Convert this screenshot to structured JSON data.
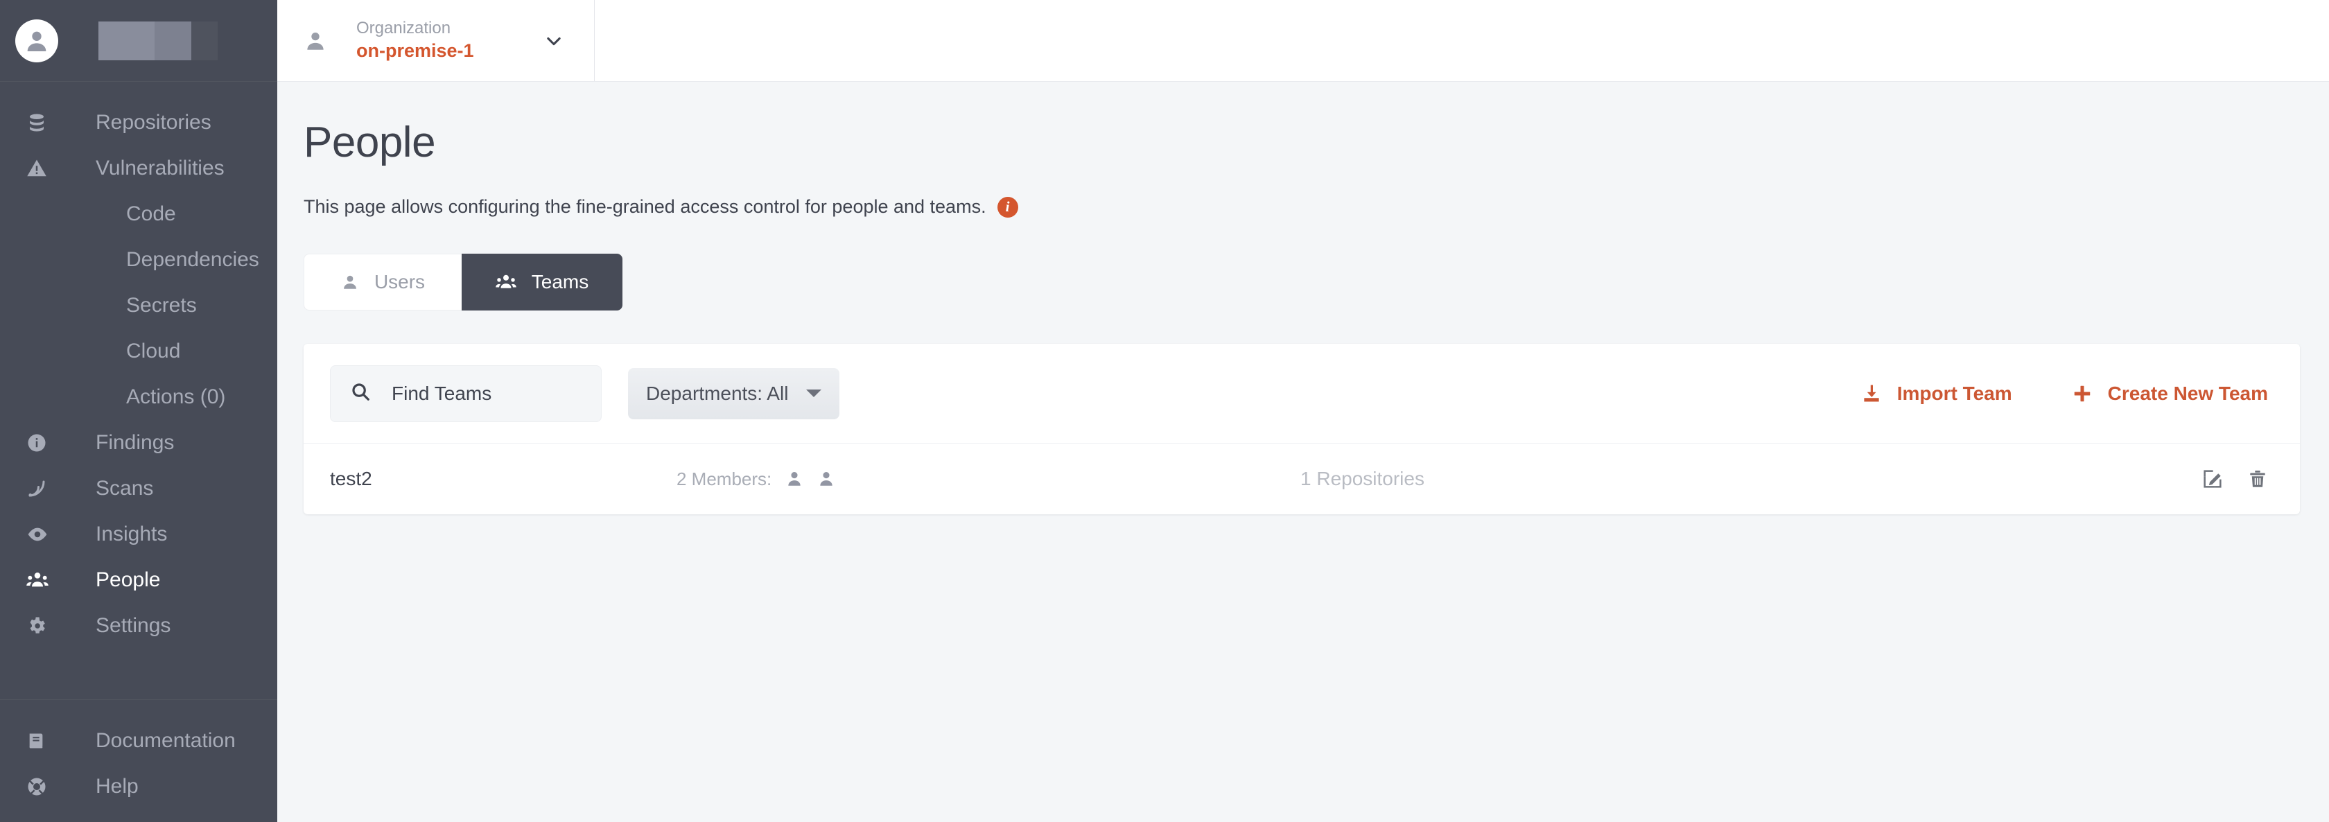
{
  "sidebar": {
    "user_avatar_icon": "user-avatar-icon",
    "redacted_label": "",
    "nav": [
      {
        "label": "Repositories",
        "icon": "database-icon",
        "sub": false,
        "active": false
      },
      {
        "label": "Vulnerabilities",
        "icon": "warning-triangle-icon",
        "sub": false,
        "active": false
      },
      {
        "label": "Code",
        "icon": "",
        "sub": true,
        "active": false
      },
      {
        "label": "Dependencies",
        "icon": "",
        "sub": true,
        "active": false
      },
      {
        "label": "Secrets",
        "icon": "",
        "sub": true,
        "active": false
      },
      {
        "label": "Cloud",
        "icon": "",
        "sub": true,
        "active": false
      },
      {
        "label": "Actions (0)",
        "icon": "",
        "sub": true,
        "active": false
      },
      {
        "label": "Findings",
        "icon": "info-circle-icon",
        "sub": false,
        "active": false
      },
      {
        "label": "Scans",
        "icon": "signal-icon",
        "sub": false,
        "active": false
      },
      {
        "label": "Insights",
        "icon": "eye-icon",
        "sub": false,
        "active": false
      },
      {
        "label": "People",
        "icon": "people-group-icon",
        "sub": false,
        "active": true
      },
      {
        "label": "Settings",
        "icon": "gear-icon",
        "sub": false,
        "active": false
      }
    ],
    "footer_nav": [
      {
        "label": "Documentation",
        "icon": "book-icon"
      },
      {
        "label": "Help",
        "icon": "life-ring-icon"
      }
    ]
  },
  "topbar": {
    "org_icon": "person-icon",
    "org_caption": "Organization",
    "org_value": "on-premise-1",
    "org_caret_icon": "chevron-down-icon"
  },
  "page": {
    "title": "People",
    "description": "This page allows configuring the fine-grained access control for people and teams.",
    "info_icon": "info-icon",
    "info_glyph": "i"
  },
  "tabs": [
    {
      "label": "Users",
      "icon": "person-icon",
      "active": false
    },
    {
      "label": "Teams",
      "icon": "people-group-icon",
      "active": true
    }
  ],
  "toolbar": {
    "search_icon": "search-icon",
    "search_placeholder": "Find Teams",
    "search_value": "",
    "department_filter": "Departments: All",
    "department_caret_icon": "caret-down-icon",
    "import_label": "Import Team",
    "import_icon": "import-download-icon",
    "create_label": "Create New Team",
    "create_icon": "plus-icon"
  },
  "teams": [
    {
      "name": "test2",
      "members_label": "2 Members:",
      "member_count": 2,
      "repositories": "1 Repositories",
      "edit_icon": "edit-pencil-icon",
      "delete_icon": "trash-icon"
    }
  ],
  "colors": {
    "accent": "#d4562e",
    "sidebar_bg": "#474b57",
    "page_bg": "#f4f6f8",
    "card_bg": "#ffffff",
    "muted_text": "#a7abb7"
  }
}
